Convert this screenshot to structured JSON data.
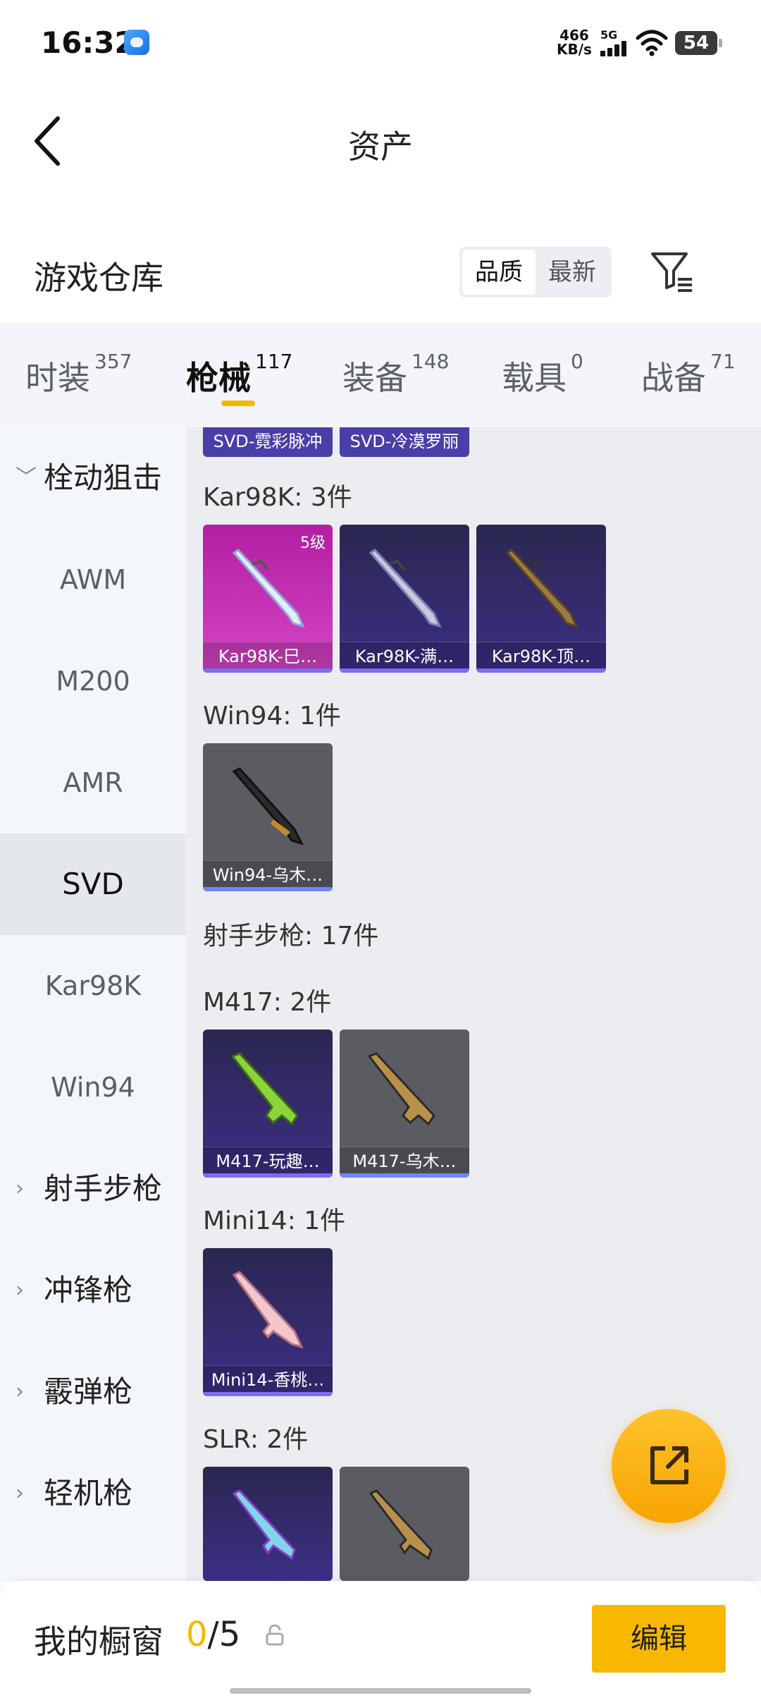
{
  "status_bar": {
    "time": "16:32",
    "speed_value": "466",
    "speed_unit": "KB/s",
    "network": "5G",
    "battery": "54"
  },
  "header": {
    "title": "资产"
  },
  "section": {
    "title": "游戏仓库",
    "sort_quality": "品质",
    "sort_latest": "最新"
  },
  "tabs": [
    {
      "label": "时装",
      "count": "357"
    },
    {
      "label": "枪械",
      "count": "117"
    },
    {
      "label": "装备",
      "count": "148"
    },
    {
      "label": "载具",
      "count": "0"
    },
    {
      "label": "战备",
      "count": "71"
    }
  ],
  "sidebar": {
    "items": [
      {
        "label": "栓动狙击",
        "type": "category"
      },
      {
        "label": "AWM"
      },
      {
        "label": "M200"
      },
      {
        "label": "AMR"
      },
      {
        "label": "SVD",
        "active": true
      },
      {
        "label": "Kar98K"
      },
      {
        "label": "Win94"
      },
      {
        "label": "射手步枪",
        "type": "category"
      },
      {
        "label": "冲锋枪",
        "type": "category"
      },
      {
        "label": "霰弹枪",
        "type": "category"
      },
      {
        "label": "轻机枪",
        "type": "category"
      }
    ]
  },
  "content": {
    "top_cards": [
      "SVD-霓彩脉冲",
      "SVD-冷漠罗丽"
    ],
    "groups": [
      {
        "title": "Kar98K: 3件",
        "items": [
          {
            "name": "Kar98K-巳…",
            "level": "5级"
          },
          {
            "name": "Kar98K-满…"
          },
          {
            "name": "Kar98K-顶…"
          }
        ]
      },
      {
        "title": "Win94: 1件",
        "items": [
          {
            "name": "Win94-乌木…"
          }
        ]
      },
      {
        "title": "射手步枪: 17件"
      },
      {
        "title": "M417: 2件",
        "items": [
          {
            "name": "M417-玩趣…"
          },
          {
            "name": "M417-乌木…"
          }
        ]
      },
      {
        "title": "Mini14: 1件",
        "items": [
          {
            "name": "Mini14-香桃…"
          }
        ]
      },
      {
        "title": "SLR: 2件"
      }
    ]
  },
  "bottom": {
    "label": "我的橱窗",
    "current": "0",
    "total": "/5",
    "edit": "编辑"
  },
  "colors": {
    "accent": "#f5b800",
    "sidebar_bg": "#f3f6fb",
    "content_bg": "#ebedf1"
  }
}
